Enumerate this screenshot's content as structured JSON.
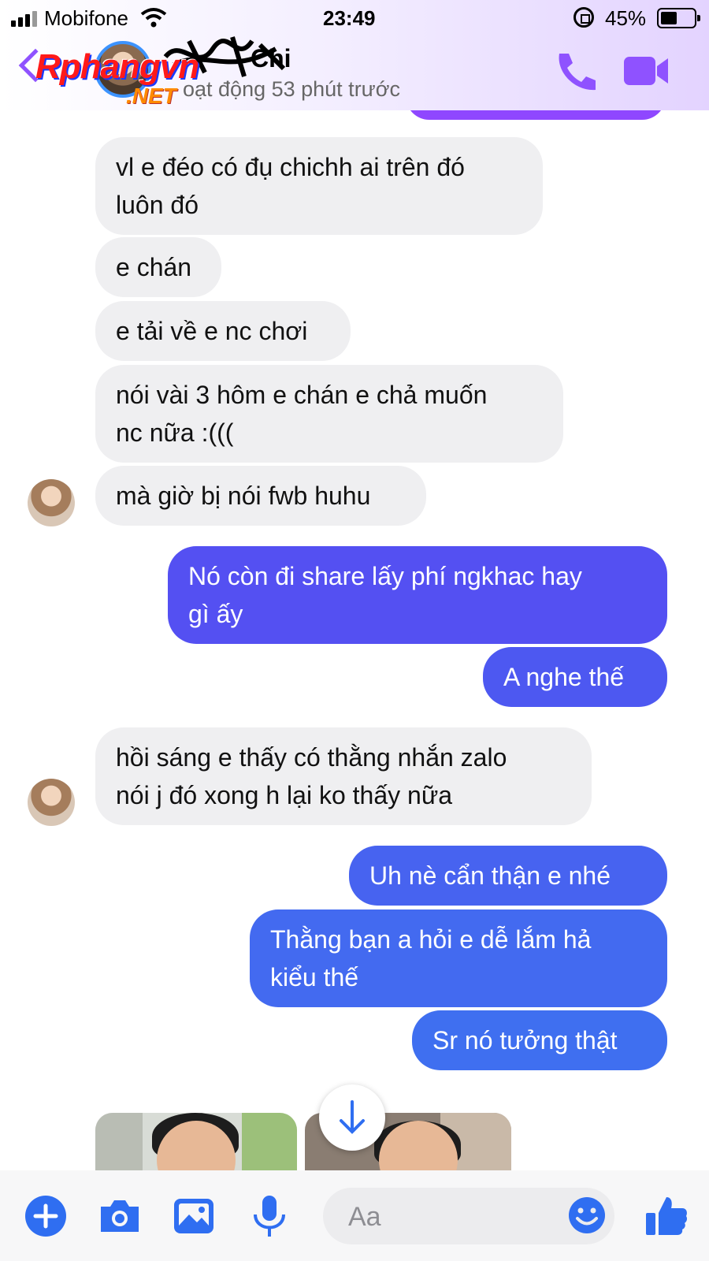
{
  "status_bar": {
    "carrier": "Mobifone",
    "time": "23:49",
    "battery_percent": "45%",
    "battery_level": 0.45
  },
  "header": {
    "contact_name": "Chi",
    "active_status": "oạt động 53 phút trước",
    "watermark": "Rphangvn",
    "watermark_suffix": ".NET",
    "accent_color": "#8f52ff"
  },
  "messages": [
    {
      "side": "in",
      "text": "vl e đéo có đụ chichh ai trên đó\nluôn đó"
    },
    {
      "side": "in",
      "text": "e chán"
    },
    {
      "side": "in",
      "text": "e tải về e nc chơi"
    },
    {
      "side": "in",
      "text": "nói vài 3 hôm e chán e chả muốn\nnc nữa :((("
    },
    {
      "side": "in",
      "text": "mà giờ bị nói fwb huhu"
    },
    {
      "side": "out",
      "text": "Nó còn đi share lấy phí ngkhac hay\ngì ấy"
    },
    {
      "side": "out",
      "text": "A nghe thế"
    },
    {
      "side": "in",
      "text": "hồi sáng e thấy có thằng nhắn zalo\nnói j đó xong h lại ko thấy nữa"
    },
    {
      "side": "out",
      "text": "Uh nè cẩn thận e nhé"
    },
    {
      "side": "out",
      "text": "Thằng bạn a hỏi e dễ lắm hả\nkiểu thế"
    },
    {
      "side": "out",
      "text": "Sr nó tưởng thật"
    }
  ],
  "composer": {
    "placeholder": "Aa",
    "icons": [
      "plus-icon",
      "camera-icon",
      "image-icon",
      "microphone-icon",
      "emoji-icon",
      "thumbs-up-icon"
    ],
    "icon_color": "#2f6ef1"
  },
  "colors": {
    "incoming_bubble": "#efeff1",
    "outgoing_gradient_top": "#5b4ef3",
    "outgoing_gradient_bottom": "#3f6ff0"
  }
}
